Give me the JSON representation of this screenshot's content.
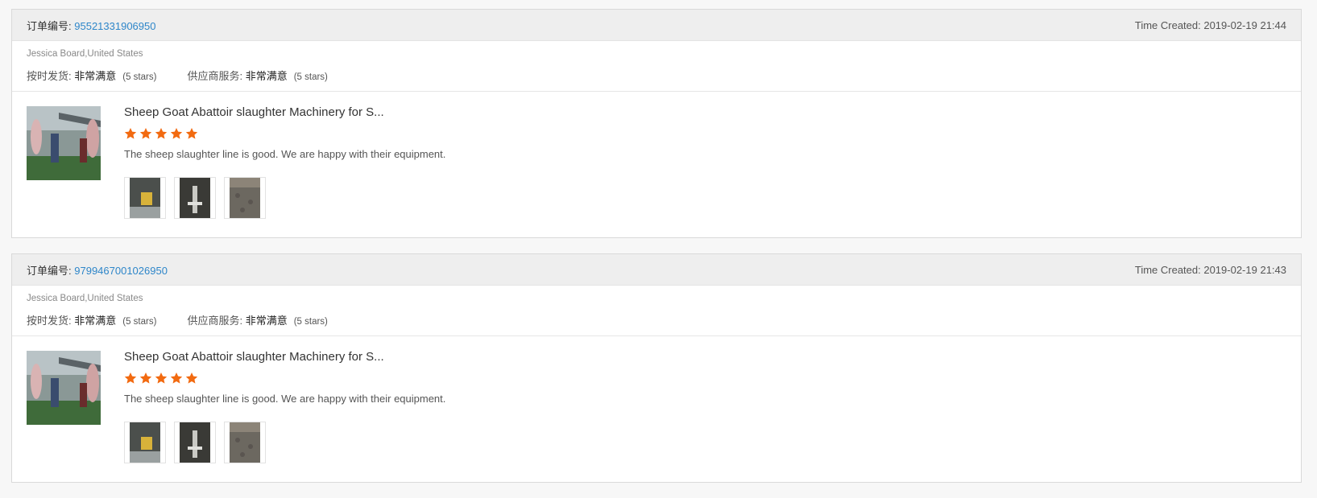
{
  "colors": {
    "link": "#2e86c9",
    "star": "#f26a10",
    "header_bg": "#eeeeee"
  },
  "orders": [
    {
      "order_label": "订单编号:",
      "order_number": "95521331906950",
      "time_created": "Time Created: 2019-02-19 21:44",
      "buyer": "Jessica Board,United States",
      "ratings": [
        {
          "label": "按时发货:",
          "value": "非常满意",
          "stars_text": "(5 stars)"
        },
        {
          "label": "供应商服务:",
          "value": "非常满意",
          "stars_text": "(5 stars)"
        }
      ],
      "product_title": "Sheep Goat Abattoir slaughter Machinery for S...",
      "star_rating": 5,
      "review_text": "The sheep slaughter line is good. We are happy with their equipment.",
      "photo_icons": [
        "product-photo-1",
        "product-photo-2",
        "product-photo-3"
      ]
    },
    {
      "order_label": "订单编号:",
      "order_number": "9799467001026950",
      "time_created": "Time Created: 2019-02-19 21:43",
      "buyer": "Jessica Board,United States",
      "ratings": [
        {
          "label": "按时发货:",
          "value": "非常满意",
          "stars_text": "(5 stars)"
        },
        {
          "label": "供应商服务:",
          "value": "非常满意",
          "stars_text": "(5 stars)"
        }
      ],
      "product_title": "Sheep Goat Abattoir slaughter Machinery for S...",
      "star_rating": 5,
      "review_text": "The sheep slaughter line is good. We are happy with their equipment.",
      "photo_icons": [
        "product-photo-1",
        "product-photo-2",
        "product-photo-3"
      ]
    }
  ]
}
